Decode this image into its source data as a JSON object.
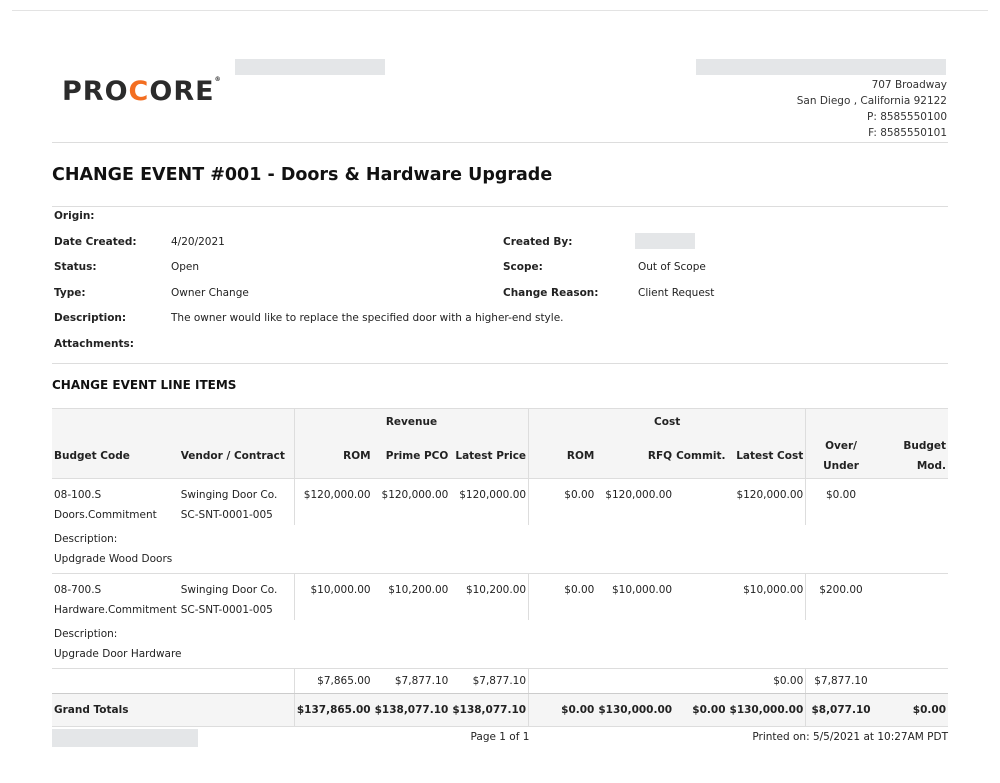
{
  "company": {
    "logo_text_left": "PRO",
    "logo_text_accent": "C",
    "logo_text_right": "ORE",
    "logo_mark": "®",
    "address_line1": "707 Broadway",
    "address_line2": "San Diego , California 92122",
    "phone": "P: 8585550100",
    "fax": "F: 8585550101"
  },
  "title": "CHANGE EVENT #001 - Doors & Hardware Upgrade",
  "info": {
    "origin_label": "Origin:",
    "date_created_label": "Date Created:",
    "date_created": "4/20/2021",
    "created_by_label": "Created By:",
    "status_label": "Status:",
    "status": "Open",
    "scope_label": "Scope:",
    "scope": "Out of Scope",
    "type_label": "Type:",
    "type": "Owner Change",
    "change_reason_label": "Change Reason:",
    "change_reason": "Client Request",
    "description_label": "Description:",
    "description": "The owner would like to replace the specified door with a higher-end style.",
    "attachments_label": "Attachments:"
  },
  "section_title": "CHANGE EVENT LINE ITEMS",
  "table": {
    "group_revenue": "Revenue",
    "group_cost": "Cost",
    "headers": {
      "budget_code": "Budget Code",
      "vendor": "Vendor / Contract",
      "rev_rom": "ROM",
      "prime_pco": "Prime PCO",
      "latest_price": "Latest Price",
      "cost_rom": "ROM",
      "rfq": "RFQ",
      "commit": "Commit.",
      "latest_cost": "Latest Cost",
      "over_under_1": "Over/",
      "over_under_2": "Under",
      "budget_mod_1": "Budget",
      "budget_mod_2": "Mod."
    },
    "items": [
      {
        "code_1": "08-100.S",
        "code_2": "Doors.Commitment",
        "vendor_1": "Swinging Door Co.",
        "vendor_2": "SC-SNT-0001-005",
        "rev_rom": "$120,000.00",
        "prime_pco": "$120,000.00",
        "latest_price": "$120,000.00",
        "cost_rom": "$0.00",
        "rfq": "$120,000.00",
        "commit": "",
        "latest_cost": "$120,000.00",
        "over_under": "$0.00",
        "budget_mod": "",
        "desc_label": "Description:",
        "desc": "Updgrade Wood Doors"
      },
      {
        "code_1": "08-700.S",
        "code_2": "Hardware.Commitment",
        "vendor_1": "Swinging Door Co.",
        "vendor_2": "SC-SNT-0001-005",
        "rev_rom": "$10,000.00",
        "prime_pco": "$10,200.00",
        "latest_price": "$10,200.00",
        "cost_rom": "$0.00",
        "rfq": "$10,000.00",
        "commit": "",
        "latest_cost": "$10,000.00",
        "over_under": "$200.00",
        "budget_mod": "",
        "desc_label": "Description:",
        "desc": "Upgrade Door Hardware"
      }
    ],
    "subtotal": {
      "rev_rom": "$7,865.00",
      "prime_pco": "$7,877.10",
      "latest_price": "$7,877.10",
      "latest_cost": "$0.00",
      "over_under": "$7,877.10"
    },
    "grand_totals": {
      "label": "Grand Totals",
      "rev_rom": "$137,865.00",
      "prime_pco": "$138,077.10",
      "latest_price": "$138,077.10",
      "cost_rom": "$0.00",
      "rfq": "$130,000.00",
      "commit": "$0.00",
      "latest_cost": "$130,000.00",
      "over_under": "$8,077.10",
      "budget_mod": "$0.00"
    }
  },
  "footer": {
    "page": "Page 1 of 1",
    "printed": "Printed on: 5/5/2021 at 10:27AM PDT"
  }
}
